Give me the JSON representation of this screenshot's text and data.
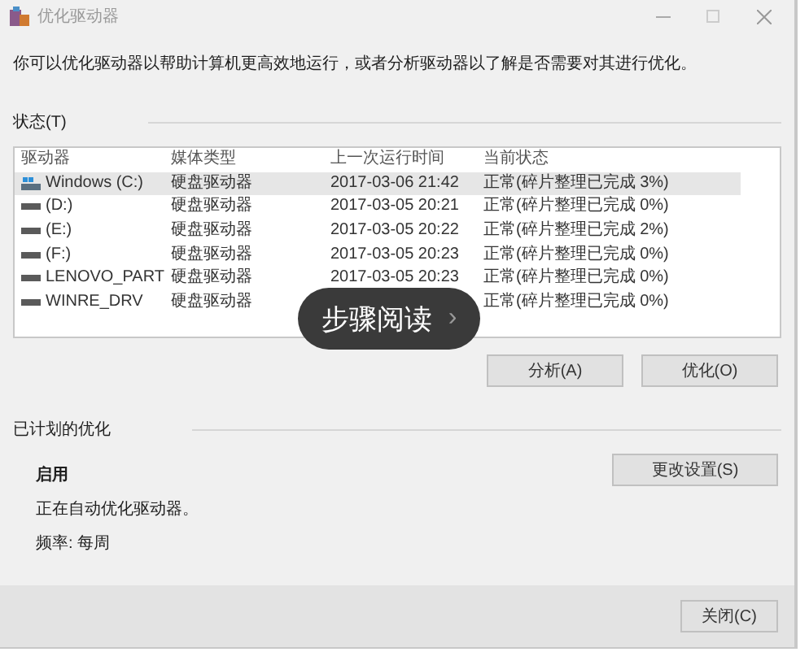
{
  "window": {
    "title": "优化驱动器"
  },
  "description": "你可以优化驱动器以帮助计算机更高效地运行，或者分析驱动器以了解是否需要对其进行优化。",
  "status_section": {
    "label": "状态(T)",
    "table": {
      "columns": [
        "驱动器",
        "媒体类型",
        "上一次运行时间",
        "当前状态"
      ],
      "rows": [
        {
          "kind": "system",
          "selected": true,
          "drive": "Windows (C:)",
          "media": "硬盘驱动器",
          "last_run": "2017-03-06 21:42",
          "status": "正常(碎片整理已完成 3%)"
        },
        {
          "kind": "disk",
          "selected": false,
          "drive": "(D:)",
          "media": "硬盘驱动器",
          "last_run": "2017-03-05 20:21",
          "status": "正常(碎片整理已完成 0%)"
        },
        {
          "kind": "disk",
          "selected": false,
          "drive": "(E:)",
          "media": "硬盘驱动器",
          "last_run": "2017-03-05 20:22",
          "status": "正常(碎片整理已完成 2%)"
        },
        {
          "kind": "disk",
          "selected": false,
          "drive": "(F:)",
          "media": "硬盘驱动器",
          "last_run": "2017-03-05 20:23",
          "status": "正常(碎片整理已完成 0%)"
        },
        {
          "kind": "disk",
          "selected": false,
          "drive": "LENOVO_PART",
          "media": "硬盘驱动器",
          "last_run": "2017-03-05 20:23",
          "status": "正常(碎片整理已完成 0%)"
        },
        {
          "kind": "disk",
          "selected": false,
          "drive": "WINRE_DRV",
          "media": "硬盘驱动器",
          "status": "正常(碎片整理已完成 0%)"
        }
      ]
    },
    "buttons": [
      "分析(A)",
      "优化(O)"
    ]
  },
  "overlay_button": {
    "label": "步骤阅读",
    "arrow": "›"
  },
  "scheduled_section": {
    "label": "已计划的优化",
    "state": "启用",
    "note": "正在自动优化驱动器。",
    "frequency": "频率: 每周",
    "button": "更改设置(S)"
  },
  "footer": {
    "close_button": "关闭(C)"
  }
}
